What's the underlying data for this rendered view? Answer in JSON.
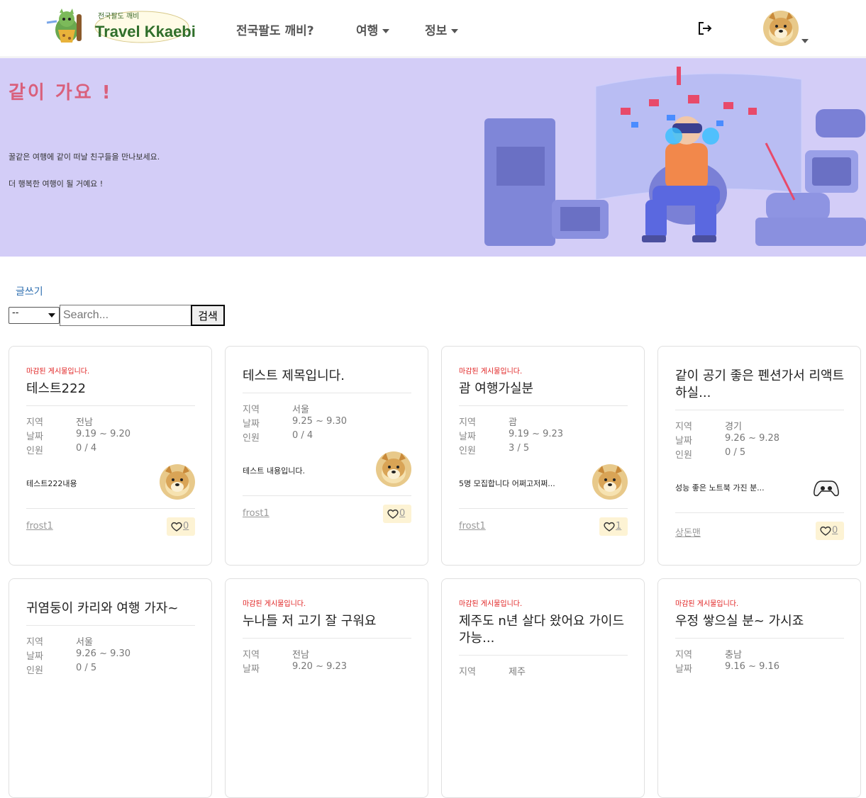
{
  "nav": {
    "logo_title": "Travel Kkaebi",
    "logo_sub": "전국팔도 깨비",
    "links": [
      "전국팔도 깨비?",
      "여행",
      "정보"
    ]
  },
  "hero": {
    "title": "같이 가요 !",
    "line1": "꿀같은 여행에 같이 떠날 친구들을 만나보세요.",
    "line2": "더 행복한 여행이 될 거예요 !"
  },
  "toolbar": {
    "write_label": "글쓰기",
    "select_value": "--",
    "search_placeholder": "Search...",
    "search_button": "검색"
  },
  "labels": {
    "region": "지역",
    "date": "날짜",
    "people": "인원"
  },
  "cards": [
    {
      "closed": "마감된 게시물입니다.",
      "title": "테스트222",
      "region": "전남",
      "date": "9.19 ~ 9.20",
      "people": "0 / 4",
      "content": "테스트222내용",
      "author": "frost1",
      "likes": "0",
      "avatar": "doge"
    },
    {
      "closed": "",
      "title": "테스트 제목입니다.",
      "region": "서울",
      "date": "9.25 ~ 9.30",
      "people": "0 / 4",
      "content": "테스트 내용입니다.",
      "author": "frost1",
      "likes": "0",
      "avatar": "doge"
    },
    {
      "closed": "마감된 게시물입니다.",
      "title": "괌 여행가실분",
      "region": "괌",
      "date": "9.19 ~ 9.23",
      "people": "3 / 5",
      "content": "5명 모집합니다 어쩌고저쩌...",
      "author": "frost1",
      "likes": "1",
      "avatar": "doge"
    },
    {
      "closed": "",
      "title": "같이 공기 좋은 펜션가서 리액트 하실...",
      "region": "경기",
      "date": "9.26 ~ 9.28",
      "people": "0 / 5",
      "content": "성능 좋은 노트북 가진 분...",
      "author": "상돈맨",
      "likes": "0",
      "avatar": "controller"
    },
    {
      "closed": "",
      "title": "귀염둥이 카리와 여행 가자~",
      "region": "서울",
      "date": "9.26 ~ 9.30",
      "people": "0 / 5",
      "content": "",
      "author": "",
      "likes": "",
      "avatar": ""
    },
    {
      "closed": "마감된 게시물입니다.",
      "title": "누나들 저 고기 잘 구워요",
      "region": "전남",
      "date": "9.20 ~ 9.23",
      "people": "",
      "content": "",
      "author": "",
      "likes": "",
      "avatar": ""
    },
    {
      "closed": "마감된 게시물입니다.",
      "title": "제주도 n년 살다 왔어요 가이드 가능...",
      "region": "제주",
      "date": "",
      "people": "",
      "content": "",
      "author": "",
      "likes": "",
      "avatar": ""
    },
    {
      "closed": "마감된 게시물입니다.",
      "title": "우정 쌓으실 분~ 가시죠",
      "region": "충남",
      "date": "9.16 ~ 9.16",
      "people": "",
      "content": "",
      "author": "",
      "likes": "",
      "avatar": ""
    }
  ],
  "colors": {
    "hero_bg": "#d3cdf7",
    "hero_title": "#d9607c",
    "closed_text": "#e02020",
    "like_bg": "#fdf3d4",
    "link": "#2f6fb0"
  }
}
